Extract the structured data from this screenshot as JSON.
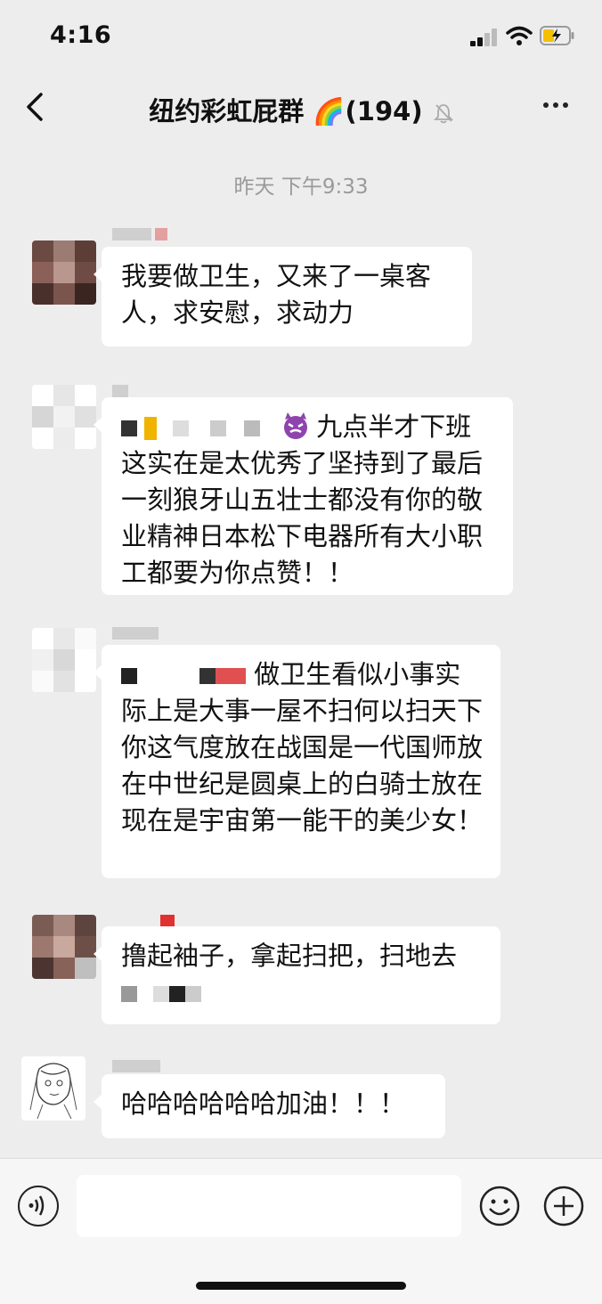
{
  "status": {
    "time": "4:16"
  },
  "header": {
    "title": "纽约彩虹屁群",
    "emoji": "🌈",
    "count": "(194)"
  },
  "timestamp": "昨天 下午9:33",
  "messages": [
    {
      "text": "我要做卫生，又来了一桌客人，求安慰，求动力"
    },
    {
      "text": "九点半才下班这实在是太优秀了坚持到了最后一刻狼牙山五壮士都没有你的敬业精神日本松下电器所有大小职工都要为你点赞！！"
    },
    {
      "text": "做卫生看似小事实际上是大事一屋不扫何以扫天下你这气度放在战国是一代国师放在中世纪是圆桌上的白骑士放在现在是宇宙第一能干的美少女！"
    },
    {
      "text": "撸起袖子，拿起扫把，扫地去"
    },
    {
      "text": "哈哈哈哈哈哈加油！！！"
    }
  ],
  "icons": [
    "back-arrow-icon",
    "mute-bell-icon",
    "more-icon",
    "voice-icon",
    "emoji-icon",
    "add-icon"
  ]
}
